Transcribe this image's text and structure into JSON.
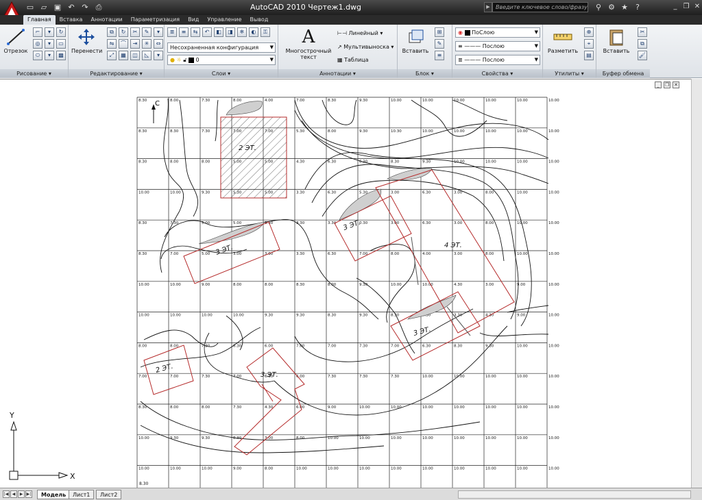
{
  "window": {
    "title": "AutoCAD 2010    Чертеж1.dwg",
    "search_placeholder": "Введите ключевое слово/фразу"
  },
  "tabs": [
    "Главная",
    "Вставка",
    "Аннотации",
    "Параметризация",
    "Вид",
    "Управление",
    "Вывод"
  ],
  "ribbon": {
    "draw": {
      "title": "Рисование",
      "line_label": "Отрезок"
    },
    "modify": {
      "title": "Редактирование",
      "move_label": "Перенести"
    },
    "layers": {
      "title": "Слои",
      "layer_state": "Несохраненная конфигурация слоев",
      "current_layer": "0"
    },
    "annotation": {
      "title": "Аннотации",
      "mtext_label": "Многострочный текст",
      "linear_label": "Линейный",
      "multileader_label": "Мультивыноска",
      "table_label": "Таблица"
    },
    "block": {
      "title": "Блок",
      "insert_label": "Вставить"
    },
    "properties": {
      "title": "Свойства",
      "color": "ПоСлою",
      "linetype": "Послою",
      "lineweight": "Послою"
    },
    "utilities": {
      "title": "Утилиты",
      "measure_label": "Разметить"
    },
    "clipboard": {
      "title": "Буфер обмена",
      "paste_label": "Вставить"
    }
  },
  "drawing": {
    "north_label": "С",
    "ucs_x": "X",
    "ucs_y": "Y",
    "buildings": [
      {
        "label": "2 ЭТ."
      },
      {
        "label": "3 ЭТ."
      },
      {
        "label": "3 ЭТ."
      },
      {
        "label": "4 ЭТ."
      },
      {
        "label": "3 ЭТ."
      },
      {
        "label": "2 ЭТ."
      },
      {
        "label": "3 ЭТ."
      }
    ],
    "grid_values": [
      [
        "8.30",
        "8.00",
        "7.30",
        "8.00",
        "4.00",
        "7.00",
        "8.30",
        "9.30",
        "10.00",
        "10.00",
        "10.00",
        "10.00",
        "10.00",
        "10.00"
      ],
      [
        "8.30",
        "8.30",
        "7.30",
        "7.00",
        "7.00",
        "5.30",
        "8.00",
        "9.30",
        "10.30",
        "10.00",
        "10.00",
        "10.00",
        "10.00",
        "10.00"
      ],
      [
        "8.30",
        "8.00",
        "8.00",
        "5.00",
        "5.00",
        "4.30",
        "6.30",
        "6.30",
        "8.30",
        "9.30",
        "10.00",
        "10.00",
        "10.00",
        "10.00"
      ],
      [
        "10.00",
        "10.00",
        "9.30",
        "5.30",
        "5.00",
        "3.30",
        "6.30",
        "5.30",
        "3.00",
        "6.30",
        "3.00",
        "8.00",
        "10.00",
        "10.00"
      ],
      [
        "8.30",
        "7.30",
        "5.00",
        "5.00",
        "3.30",
        "3.30",
        "3.30",
        "0.30",
        "3.00",
        "6.30",
        "3.00",
        "8.00",
        "10.00",
        "10.00"
      ],
      [
        "8.30",
        "7.00",
        "5.00",
        "3.00",
        "3.00",
        "3.30",
        "6.30",
        "7.00",
        "8.00",
        "4.00",
        "3.00",
        "8.00",
        "10.00",
        "10.00"
      ],
      [
        "10.00",
        "10.00",
        "9.00",
        "8.00",
        "8.00",
        "8.30",
        "8.00",
        "9.30",
        "10.00",
        "10.00",
        "4.30",
        "3.00",
        "9.00",
        "10.00"
      ],
      [
        "10.00",
        "10.00",
        "10.00",
        "10.00",
        "9.30",
        "9.30",
        "8.30",
        "9.30",
        "8.30",
        "6.30",
        "3.30",
        "4.30",
        "9.00",
        "10.00"
      ],
      [
        "8.00",
        "8.00",
        "7.30",
        "6.30",
        "6.00",
        "7.00",
        "7.00",
        "7.30",
        "7.00",
        "6.30",
        "8.30",
        "9.30",
        "10.00",
        "10.00"
      ],
      [
        "7.00",
        "7.00",
        "7.30",
        "7.00",
        "6.30",
        "6.00",
        "7.30",
        "7.30",
        "7.30",
        "10.00",
        "10.00",
        "10.00",
        "10.00",
        "10.00"
      ],
      [
        "8.30",
        "8.00",
        "8.00",
        "7.30",
        "4.30",
        "6.00",
        "9.00",
        "10.00",
        "10.00",
        "10.00",
        "10.00",
        "10.00",
        "10.00",
        "10.00"
      ],
      [
        "10.00",
        "9.30",
        "9.30",
        "8.30",
        "3.00",
        "8.00",
        "10.00",
        "10.00",
        "10.00",
        "10.00",
        "10.00",
        "10.00",
        "10.00",
        "10.00"
      ],
      [
        "10.00",
        "10.00",
        "10.00",
        "9.00",
        "8.00",
        "10.00",
        "10.00",
        "10.00",
        "10.00",
        "10.00",
        "10.00",
        "10.00",
        "10.00",
        "10.00"
      ],
      [
        "10.00",
        "10.00",
        "10.00",
        "10.00",
        "8.30",
        "10.00",
        "10.00",
        "10.00",
        "10.00",
        "10.00",
        "10.00",
        "10.00",
        "10.00",
        "10.00"
      ]
    ],
    "corner_value": "8.30"
  },
  "layout_tabs": [
    "Модель",
    "Лист1",
    "Лист2"
  ],
  "icons": [
    "autocad-logo-icon",
    "new-icon",
    "open-icon",
    "save-icon",
    "undo-icon",
    "redo-icon",
    "print-icon",
    "search-icon",
    "gear-icon",
    "star-icon",
    "help-icon"
  ]
}
